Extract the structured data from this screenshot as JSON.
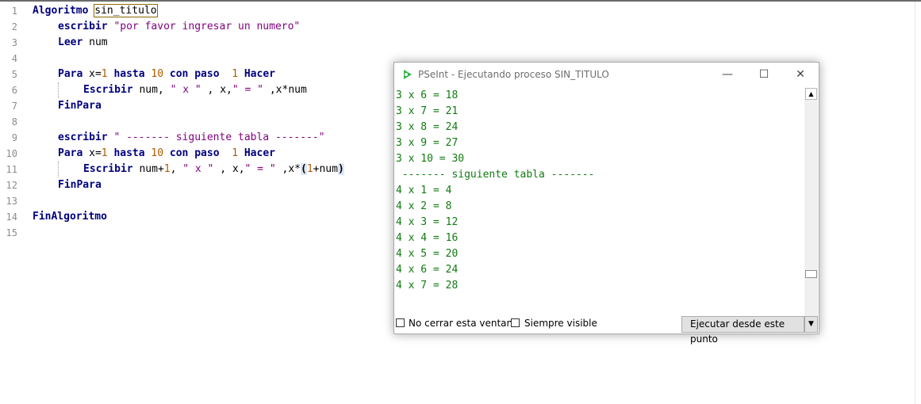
{
  "editor": {
    "line_numbers": [
      "1",
      "2",
      "3",
      "4",
      "5",
      "6",
      "7",
      "8",
      "9",
      "10",
      "11",
      "12",
      "13",
      "14",
      "15"
    ],
    "line1": {
      "kw": "Algoritmo ",
      "name": "sin_titulo"
    },
    "line2": {
      "kw": "escribir ",
      "str": "\"por favor ingresar un numero\""
    },
    "line3": {
      "kw": "Leer ",
      "var": "num"
    },
    "line5": {
      "kw1": "Para ",
      "p1": "x",
      "op1": "=",
      "n1": "1",
      "kw2": " hasta ",
      "n2": "10",
      "kw3": " con paso ",
      "n3": "1",
      "kw4": " Hacer"
    },
    "line6": {
      "kw": "Escribir ",
      "p1": "num, ",
      "s1": "\" x \"",
      "p2": " , x,",
      "s2": "\" = \"",
      "p3": " ,x",
      "op": "*",
      "p4": "num"
    },
    "line7": {
      "kw": "FinPara"
    },
    "line9": {
      "kw": "escribir ",
      "str": "\" ------- siguiente tabla -------\""
    },
    "line10": {
      "kw1": "Para ",
      "p1": "x",
      "op1": "=",
      "n1": "1",
      "kw2": " hasta ",
      "n2": "10",
      "kw3": " con paso ",
      "n3": "1",
      "kw4": " Hacer"
    },
    "line11": {
      "kw": "Escribir ",
      "p1": "num",
      "op1": "+",
      "n1": "1",
      "p2": ", ",
      "s1": "\" x \"",
      "p3": " , x,",
      "s2": "\" = \"",
      "p4": " ,x",
      "op2": "*",
      "b1": "(",
      "n2": "1",
      "op3": "+",
      "p5": "num",
      "b2": ")"
    },
    "line12": {
      "kw": "FinPara"
    },
    "line14": {
      "kw": "FinAlgoritmo"
    }
  },
  "run_window": {
    "title": "PSeInt - Ejecutando proceso SIN_TITULO",
    "minimize": "—",
    "maximize": "☐",
    "close": "✕",
    "output_lines": [
      "3 x 6 = 18",
      "3 x 7 = 21",
      "3 x 8 = 24",
      "3 x 9 = 27",
      "3 x 10 = 30",
      " ------- siguiente tabla -------",
      "4 x 1 = 4",
      "4 x 2 = 8",
      "4 x 3 = 12",
      "4 x 4 = 16",
      "4 x 5 = 20",
      "4 x 6 = 24",
      "4 x 7 = 28"
    ],
    "checkbox_no_cerrar": "No cerrar esta ventana",
    "checkbox_siempre_visible": "Siempre visible",
    "run_from_point_button": "Ejecutar desde este punto",
    "scroll_up": "▲",
    "scroll_down": "▼",
    "dropdown_arrow": "▼"
  },
  "colors": {
    "keyword": "#00007f",
    "string": "#7f007f",
    "number": "#b05a00",
    "output_text": "#117a11",
    "icon_green": "#2fb54a"
  }
}
